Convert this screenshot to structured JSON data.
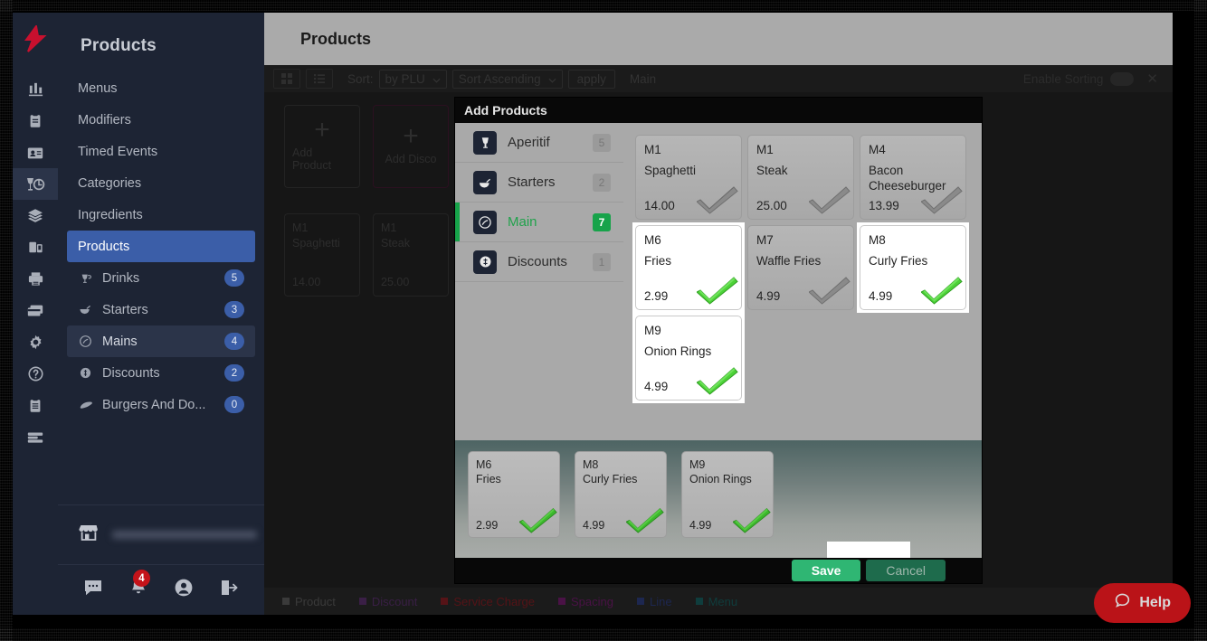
{
  "rail": {
    "logo_icon": "lightspeed-flame-logo",
    "items": [
      {
        "icon": "bar-chart-icon",
        "active": false
      },
      {
        "icon": "clipboard-icon",
        "active": false
      },
      {
        "icon": "id-card-icon",
        "active": false
      },
      {
        "icon": "wine-glass-icon",
        "active": true
      },
      {
        "icon": "layers-icon",
        "active": false
      },
      {
        "icon": "devices-icon",
        "active": false
      },
      {
        "icon": "printer-icon",
        "active": false
      },
      {
        "icon": "payment-card-icon",
        "active": false
      },
      {
        "icon": "gear-icon",
        "active": false
      },
      {
        "icon": "help-circle-icon",
        "active": false
      },
      {
        "icon": "clipboard-list-icon",
        "active": false
      },
      {
        "icon": "server-list-icon",
        "active": false
      }
    ]
  },
  "nav": {
    "title": "Products",
    "top_items": [
      {
        "label": "Menus"
      },
      {
        "label": "Modifiers"
      },
      {
        "label": "Timed Events"
      },
      {
        "label": "Categories"
      },
      {
        "label": "Ingredients"
      },
      {
        "label": "Products",
        "selected": true
      }
    ],
    "category_items": [
      {
        "label": "Drinks",
        "count": "5",
        "icon": "drink-cup-icon"
      },
      {
        "label": "Starters",
        "count": "3",
        "icon": "bowl-icon"
      },
      {
        "label": "Mains",
        "count": "4",
        "icon": "main-dish-icon",
        "highlight": true
      },
      {
        "label": "Discounts",
        "count": "2",
        "icon": "coin-icon"
      },
      {
        "label": "Burgers And Do...",
        "count": "0",
        "icon": "sausage-icon"
      }
    ],
    "store_icon": "storefront-icon",
    "footer_icons": [
      {
        "icon": "chat-icon",
        "badge": ""
      },
      {
        "icon": "bell-icon",
        "badge": "4"
      },
      {
        "icon": "user-circle-icon",
        "badge": ""
      },
      {
        "icon": "logout-icon",
        "badge": ""
      }
    ]
  },
  "main": {
    "header_title": "Products",
    "toolbar": {
      "grid_view_icon": "grid-view-icon",
      "list_view_icon": "list-view-icon",
      "sort_label": "Sort:",
      "sort_field": "by PLU",
      "sort_direction": "Sort Ascending",
      "apply_label": "apply",
      "section_label": "Main",
      "enable_sorting_label": "Enable Sorting",
      "close_icon": "close-icon"
    },
    "tiles": [
      {
        "kind": "add",
        "label": "Add Product"
      },
      {
        "kind": "add",
        "label": "Add Disco",
        "variant": "discount"
      },
      {
        "kind": "product",
        "plu": "M1",
        "name": "Spaghetti",
        "price": "14.00"
      },
      {
        "kind": "product",
        "plu": "M1",
        "name": "Steak",
        "price": "25.00"
      }
    ],
    "legend": [
      {
        "label": "Product",
        "color": "#3a3a3a"
      },
      {
        "label": "Discount",
        "color": "#3a1f46"
      },
      {
        "label": "Service Charge",
        "color": "#561317"
      },
      {
        "label": "Spacing",
        "color": "#4a1246"
      },
      {
        "label": "Line",
        "color": "#1d2750"
      },
      {
        "label": "Menu",
        "color": "#0f3d3d"
      }
    ]
  },
  "help": {
    "label": "Help",
    "icon": "chat-bubble-icon",
    "color": "#ba1318"
  },
  "modal": {
    "title": "Add Products",
    "categories": [
      {
        "label": "Aperitif",
        "count": "5",
        "icon": "drink-cup-icon",
        "selected": false
      },
      {
        "label": "Starters",
        "count": "2",
        "icon": "bowl-icon",
        "selected": false
      },
      {
        "label": "Main",
        "count": "7",
        "icon": "main-dish-icon",
        "selected": true
      },
      {
        "label": "Discounts",
        "count": "1",
        "icon": "coin-icon",
        "selected": false
      }
    ],
    "products": [
      {
        "plu": "M1",
        "name": "Spaghetti",
        "price": "14.00",
        "selected": false
      },
      {
        "plu": "M1",
        "name": "Steak",
        "price": "25.00",
        "selected": false
      },
      {
        "plu": "M4",
        "name": "Bacon Cheeseburger",
        "price": "13.99",
        "selected": false
      },
      {
        "plu": "M6",
        "name": "Fries",
        "price": "2.99",
        "selected": true
      },
      {
        "plu": "M7",
        "name": "Waffle Fries",
        "price": "4.99",
        "selected": false
      },
      {
        "plu": "M8",
        "name": "Curly Fries",
        "price": "4.99",
        "selected": true
      },
      {
        "plu": "M9",
        "name": "Onion Rings",
        "price": "4.99",
        "selected": true
      }
    ],
    "tray": [
      {
        "plu": "M6",
        "name": "Fries",
        "price": "2.99"
      },
      {
        "plu": "M8",
        "name": "Curly Fries",
        "price": "4.99"
      },
      {
        "plu": "M9",
        "name": "Onion Rings",
        "price": "4.99"
      }
    ],
    "save_label": "Save",
    "cancel_label": "Cancel",
    "accent_green": "#17a34a",
    "save_color": "#2fb673",
    "cancel_color": "#1e6b4c"
  }
}
